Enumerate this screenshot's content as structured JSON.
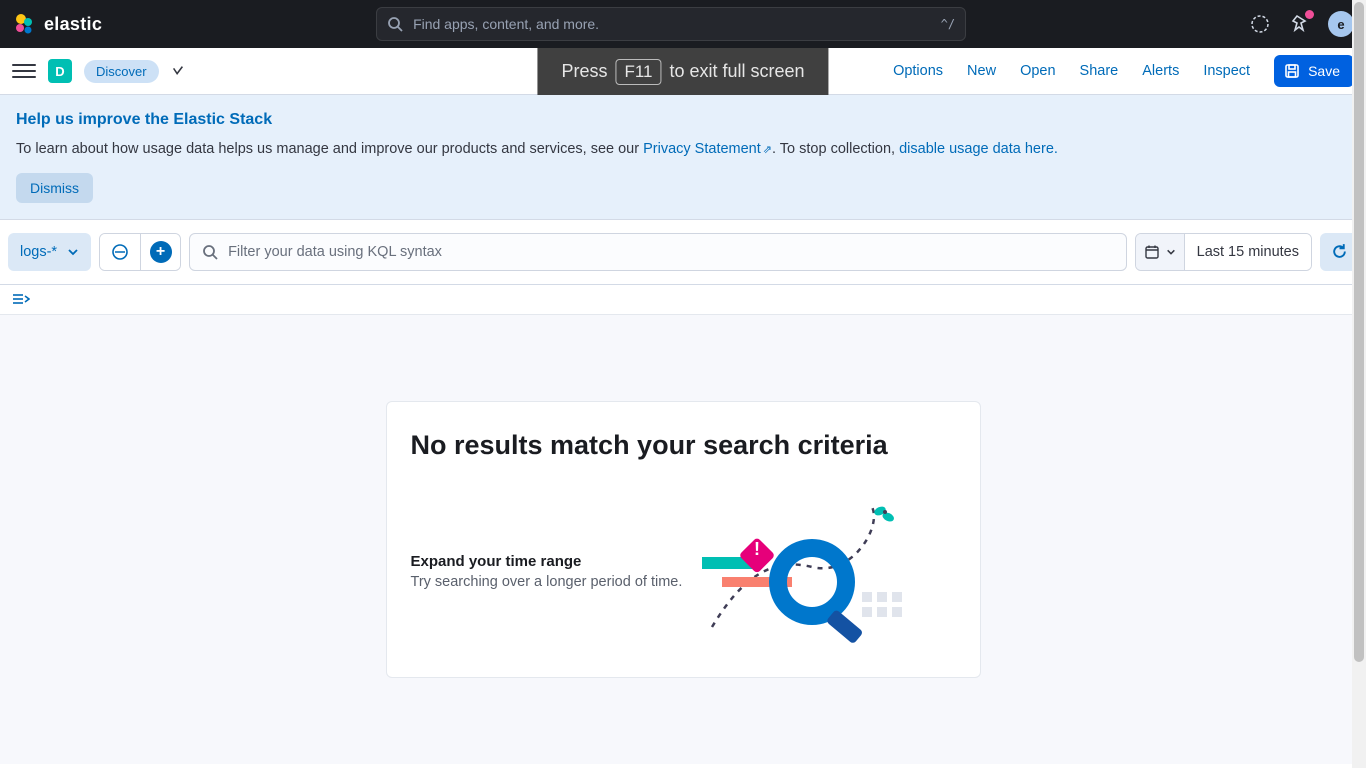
{
  "brand": "elastic",
  "global_search": {
    "placeholder": "Find apps, content, and more.",
    "kbd_hint": "^/"
  },
  "avatar_initial": "e",
  "sub_header": {
    "app_badge_letter": "D",
    "app_name": "Discover",
    "links": {
      "options": "Options",
      "new": "New",
      "open": "Open",
      "share": "Share",
      "alerts": "Alerts",
      "inspect": "Inspect"
    },
    "save_label": "Save"
  },
  "fullscreen_toast": {
    "prefix": "Press",
    "key": "F11",
    "suffix": "to exit full screen"
  },
  "banner": {
    "title": "Help us improve the Elastic Stack",
    "body_1": "To learn about how usage data helps us manage and improve our products and services, see our ",
    "privacy_link": "Privacy Statement",
    "body_2": ". To stop collection, ",
    "disable_link": "disable usage data here.",
    "dismiss_label": "Dismiss"
  },
  "query_bar": {
    "dataview": "logs-*",
    "kql_placeholder": "Filter your data using KQL syntax",
    "time_label": "Last 15 minutes"
  },
  "empty_state": {
    "heading": "No results match your search criteria",
    "sub_heading": "Expand your time range",
    "sub_body": "Try searching over a longer period of time."
  },
  "colors": {
    "link": "#006bb8",
    "primary_btn": "#0061e0",
    "teal": "#00bfb3",
    "magenta": "#f04e98"
  }
}
